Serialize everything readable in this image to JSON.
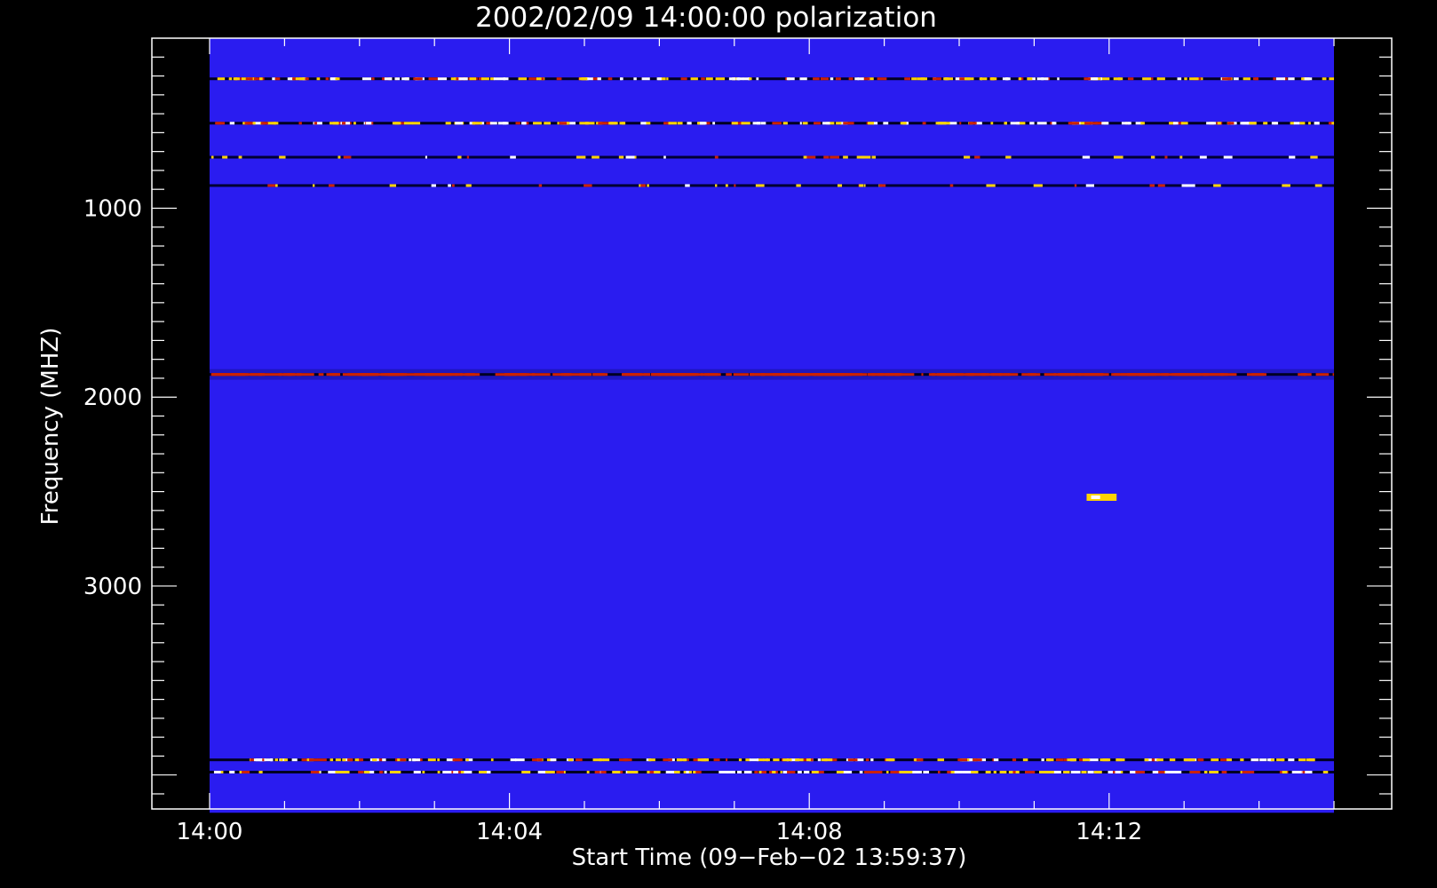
{
  "chart_data": {
    "type": "heatmap",
    "title": "2002/02/09 14:00:00 polarization",
    "xlabel": "Start Time (09−Feb−02 13:59:37)",
    "ylabel": "Frequency (MHZ)",
    "x_range": [
      "14:00",
      "14:15"
    ],
    "x_axis_limits_minutes": [
      -0.77,
      15.77
    ],
    "y_range_mhz": [
      100,
      4200
    ],
    "y_axis_limits_mhz": [
      100,
      4180
    ],
    "y_inverted": true,
    "x_ticks": [
      {
        "label": "14:00",
        "minute": 0
      },
      {
        "label": "14:04",
        "minute": 4
      },
      {
        "label": "14:08",
        "minute": 8
      },
      {
        "label": "14:12",
        "minute": 12
      }
    ],
    "y_ticks": [
      {
        "label": "1000",
        "mhz": 1000
      },
      {
        "label": "2000",
        "mhz": 2000
      },
      {
        "label": "3000",
        "mhz": 3000
      }
    ],
    "colors": {
      "background": "#000000",
      "axis": "#ffffff",
      "field": "#2a1cf0",
      "low": "#000033",
      "mid": "#cc2200",
      "high": "#ffd400",
      "peak": "#ffffff"
    },
    "features": [
      {
        "name": "interference band",
        "freq_mhz": 315,
        "t_start": 0,
        "t_end": 15,
        "intensity": "high"
      },
      {
        "name": "interference band",
        "freq_mhz": 550,
        "t_start": 0,
        "t_end": 15,
        "intensity": "high"
      },
      {
        "name": "dark band",
        "freq_mhz": 730,
        "t_start": 0,
        "t_end": 15,
        "intensity": "low"
      },
      {
        "name": "dark band",
        "freq_mhz": 880,
        "t_start": 0,
        "t_end": 15,
        "intensity": "low"
      },
      {
        "name": "polarized band",
        "freq_mhz": 1880,
        "t_start": 0,
        "t_end": 15,
        "intensity": "mid"
      },
      {
        "name": "emission spot",
        "freq_mhz": 2530,
        "t_start": 11.7,
        "t_end": 12.1,
        "intensity": "peak"
      },
      {
        "name": "interference band",
        "freq_mhz": 3920,
        "t_start": 0,
        "t_end": 15,
        "intensity": "high"
      },
      {
        "name": "interference band",
        "freq_mhz": 3985,
        "t_start": 0,
        "t_end": 15,
        "intensity": "high"
      }
    ]
  }
}
